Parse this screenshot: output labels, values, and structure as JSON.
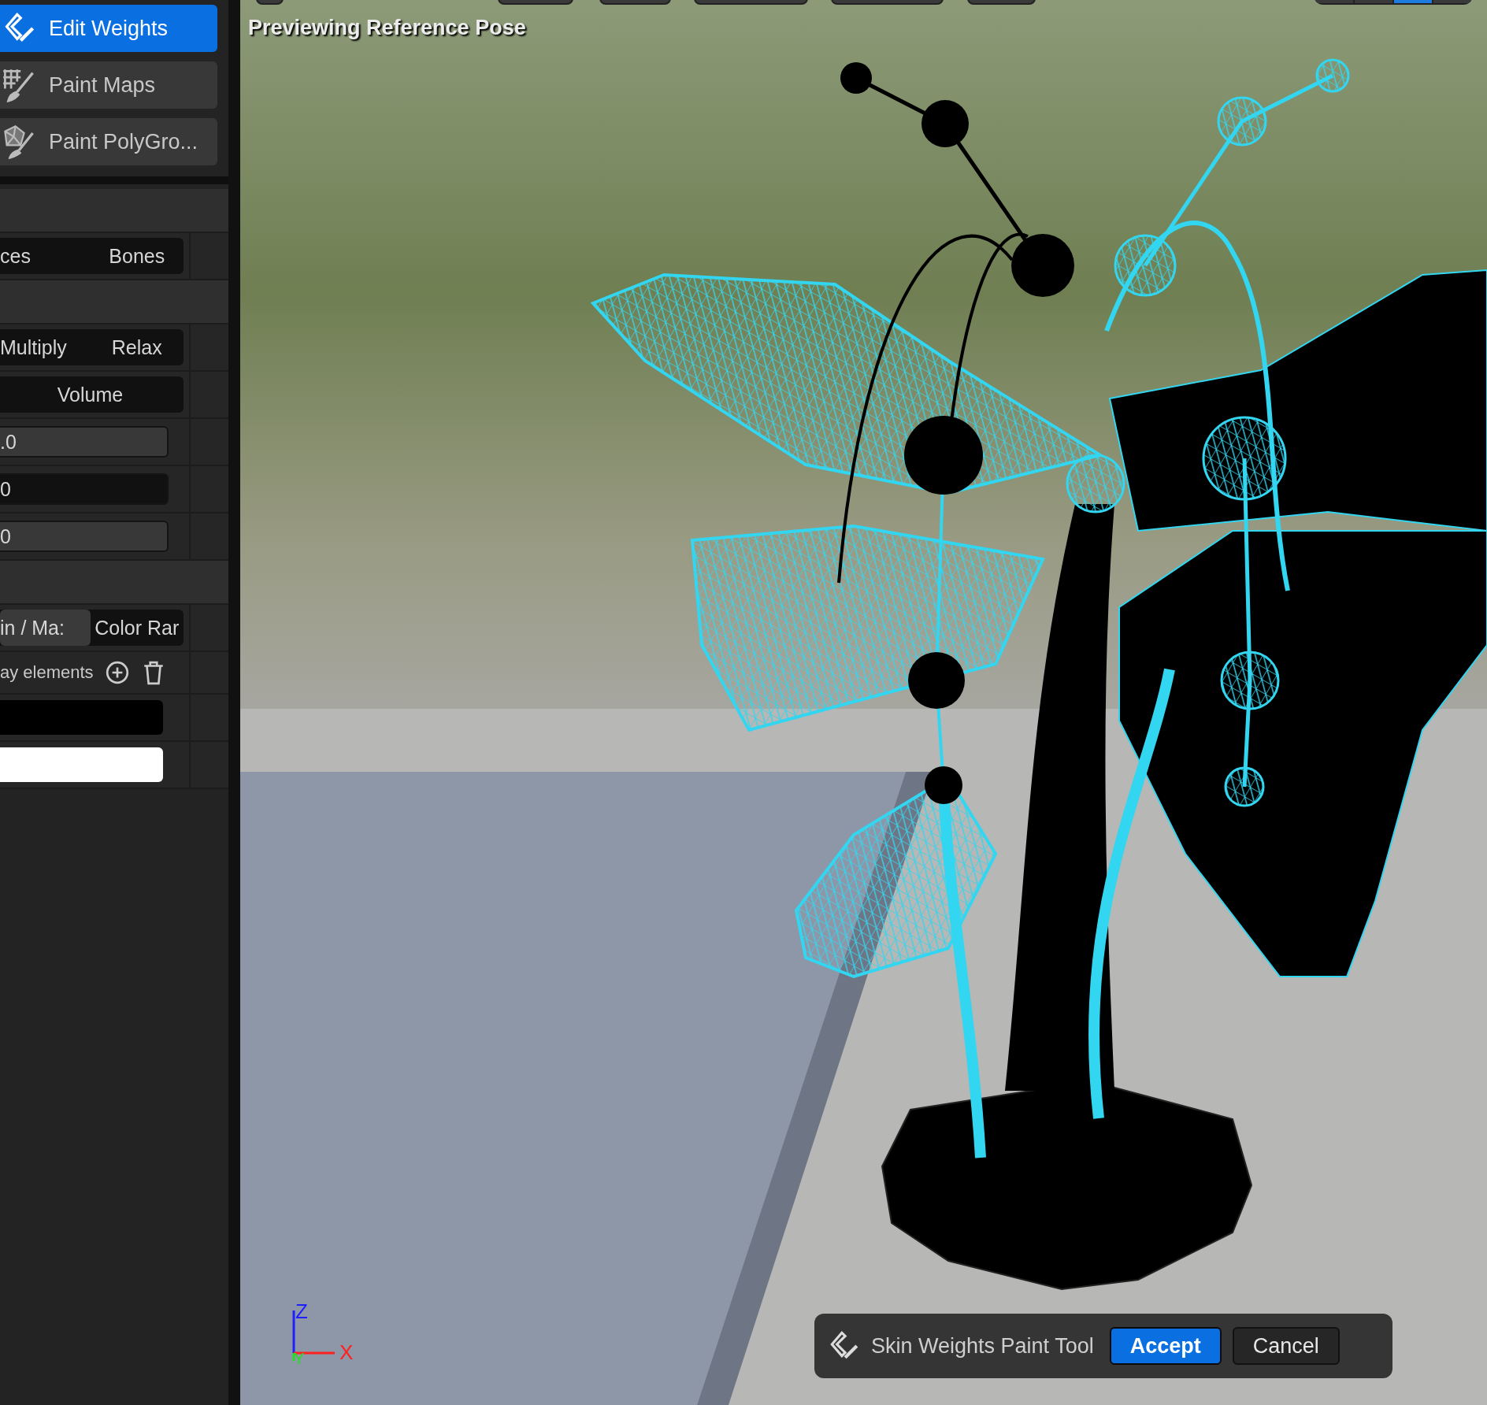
{
  "mode_buttons": [
    {
      "label": "Edit Weights",
      "selected": true
    },
    {
      "label": "Paint Maps",
      "selected": false
    },
    {
      "label": "Paint PolyGro...",
      "selected": false
    }
  ],
  "panel_rows": [
    {
      "kind": "header"
    },
    {
      "kind": "segmented",
      "options": [
        {
          "label": "ces",
          "selected": false
        },
        {
          "label": "Bones",
          "selected": false
        }
      ]
    },
    {
      "kind": "header"
    },
    {
      "kind": "segmented",
      "options": [
        {
          "label": "Multiply",
          "selected": false
        },
        {
          "label": "Relax",
          "selected": false
        }
      ]
    },
    {
      "kind": "segmented",
      "options": [
        {
          "label": "Volume",
          "selected": false
        }
      ]
    },
    {
      "kind": "field",
      "value": ".0",
      "focused": false
    },
    {
      "kind": "field",
      "value": "0",
      "focused": true
    },
    {
      "kind": "field",
      "value": "0",
      "focused": false
    },
    {
      "kind": "header"
    },
    {
      "kind": "segmented",
      "options": [
        {
          "label": "in / Ma:",
          "selected": true
        },
        {
          "label": "Color Rar",
          "selected": false
        }
      ]
    },
    {
      "kind": "array",
      "label": "ay elements"
    },
    {
      "kind": "color",
      "color": "#000000"
    },
    {
      "kind": "color",
      "color": "#ffffff"
    }
  ],
  "viewport": {
    "overlay_text": "Previewing Reference Pose",
    "view_toggles": [
      {
        "selected": false
      },
      {
        "selected": false
      },
      {
        "selected": true
      },
      {
        "selected": false
      }
    ],
    "axes": [
      {
        "label": "Z",
        "color": "#2020ff"
      },
      {
        "label": "X",
        "color": "#ff2020"
      },
      {
        "label": "Y",
        "color": "#20e020"
      }
    ]
  },
  "tool_bar": {
    "title": "Skin Weights Paint Tool",
    "buttons": [
      {
        "label": "Accept",
        "kind": "primary"
      },
      {
        "label": "Cancel",
        "kind": "secondary"
      }
    ]
  }
}
